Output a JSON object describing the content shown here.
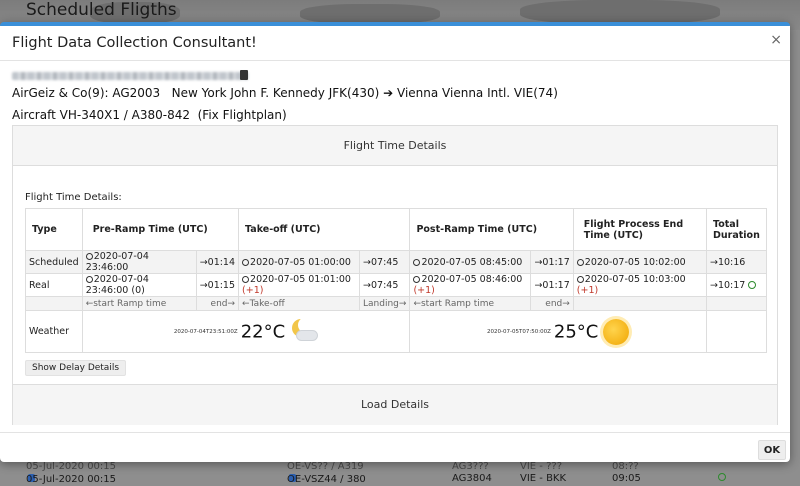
{
  "background": {
    "page_title": "Scheduled Fligths",
    "row_partial": {
      "date": "05-Jul-2020 00:15",
      "aircraft": "OE-VS?? / A319",
      "flight": "AG3???",
      "route": "VIE - ???",
      "time": "08:??"
    },
    "row": {
      "date": "05-Jul-2020 00:15",
      "aircraft": "OE-VSZ44 / 380",
      "flight": "AG3804",
      "route": "VIE - BKK",
      "time": "09:05"
    }
  },
  "modal": {
    "title": "Flight Data Collection Consultant!",
    "close_icon": "×",
    "route": {
      "airline": "AirGeiz & Co(9): AG2003",
      "origin": "New York John F. Kennedy JFK(430)",
      "arrow": "➔",
      "destination": "Vienna Vienna Intl. VIE(74)"
    },
    "aircraft": {
      "text": "Aircraft VH-340X1 / A380-842",
      "link": "(Fix Flightplan)"
    },
    "panel_flight_time": {
      "heading": "Flight Time Details",
      "label": "Flight Time Details:",
      "columns": [
        "Type",
        "Pre-Ramp Time (UTC)",
        "Take-off (UTC)",
        "Post-Ramp Time (UTC)",
        "Flight Process End Time (UTC)",
        "Total Duration"
      ],
      "scheduled": {
        "type": "Scheduled",
        "pre_ramp": "2020-07-04 23:46:00",
        "pre_ramp_dur": "→01:14",
        "takeoff": "2020-07-05 01:00:00",
        "takeoff_dur": "→07:45",
        "post_ramp": "2020-07-05 08:45:00",
        "post_ramp_dur": "→01:17",
        "end": "2020-07-05 10:02:00",
        "total": "→10:16"
      },
      "real": {
        "type": "Real",
        "pre_ramp": "2020-07-04 23:46:00 (0)",
        "pre_ramp_dur": "→01:15",
        "takeoff": "2020-07-05 01:01:00",
        "takeoff_plus": "(+1)",
        "takeoff_dur": "→07:45",
        "post_ramp": "2020-07-05 08:46:00",
        "post_ramp_plus": "(+1)",
        "post_ramp_dur": "→01:17",
        "end": "2020-07-05 10:03:00",
        "end_plus": "(+1)",
        "total": "→10:17"
      },
      "captions": {
        "start_ramp": "←start Ramp time",
        "end": "end→",
        "takeoff": "←Take-off",
        "landing": "Landing→",
        "start_ramp2": "←start Ramp time",
        "end2": "end→"
      },
      "weather": {
        "label": "Weather",
        "dep_time": "2020-07-04T23:51:00Z",
        "dep_temp": "22°C",
        "dep_icon": "moon-cloud-icon",
        "arr_time": "2020-07-05T07:50:00Z",
        "arr_temp": "25°C",
        "arr_icon": "sun-icon"
      },
      "delay_button": "Show Delay Details"
    },
    "panel_load": {
      "heading": "Load Details"
    },
    "ok_button": "OK"
  },
  "colors": {
    "accent": "#3a8fd8",
    "plus": "#c0392b",
    "smile": "#2d8a2d",
    "sun": "#f0a500"
  }
}
